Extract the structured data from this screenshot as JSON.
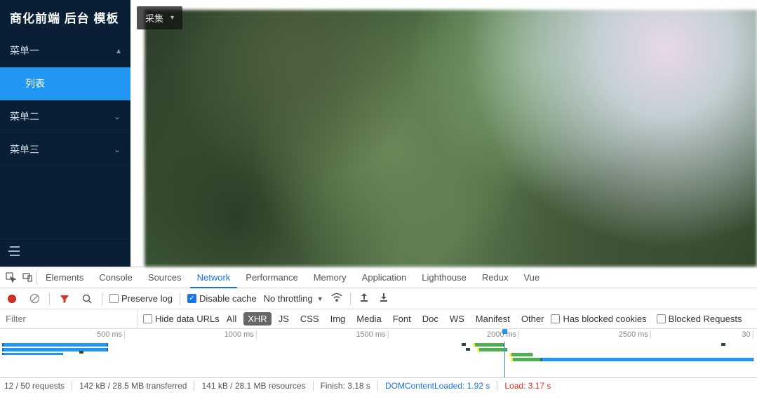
{
  "sidebar": {
    "title": "商化前端 后台 模板",
    "menus": [
      {
        "label": "菜单一",
        "chev": "▴"
      },
      {
        "label": "列表",
        "active": true
      },
      {
        "label": "菜单二",
        "chev": "⌄"
      },
      {
        "label": "菜单三",
        "chev": "⌄"
      }
    ]
  },
  "content_overlay": {
    "label": "采集",
    "chev": "▾"
  },
  "devtools": {
    "tabs": [
      "Elements",
      "Console",
      "Sources",
      "Network",
      "Performance",
      "Memory",
      "Application",
      "Lighthouse",
      "Redux",
      "Vue"
    ],
    "active_tab": "Network",
    "toolbar": {
      "preserve_log_label": "Preserve log",
      "preserve_log_checked": false,
      "disable_cache_label": "Disable cache",
      "disable_cache_checked": true,
      "throttling_label": "No throttling"
    },
    "filter": {
      "placeholder": "Filter",
      "hide_data_urls_label": "Hide data URLs",
      "types": [
        "All",
        "XHR",
        "JS",
        "CSS",
        "Img",
        "Media",
        "Font",
        "Doc",
        "WS",
        "Manifest",
        "Other"
      ],
      "type_active": "XHR",
      "has_blocked_cookies_label": "Has blocked cookies",
      "blocked_requests_label": "Blocked Requests"
    },
    "timeline": {
      "ticks": [
        {
          "label": "500 ms",
          "pct": 16.5
        },
        {
          "label": "1000 ms",
          "pct": 33.9
        },
        {
          "label": "1500 ms",
          "pct": 51.3
        },
        {
          "label": "2000 ms",
          "pct": 68.6
        },
        {
          "label": "2500 ms",
          "pct": 86.0
        },
        {
          "label": "30",
          "pct": 99.5
        }
      ],
      "playhead_pct": 66.6
    },
    "status": {
      "requests": "12 / 50 requests",
      "transferred": "142 kB / 28.5 MB transferred",
      "resources": "141 kB / 28.1 MB resources",
      "finish": "Finish: 3.18 s",
      "dcl": "DOMContentLoaded: 1.92 s",
      "load": "Load: 3.17 s"
    }
  }
}
